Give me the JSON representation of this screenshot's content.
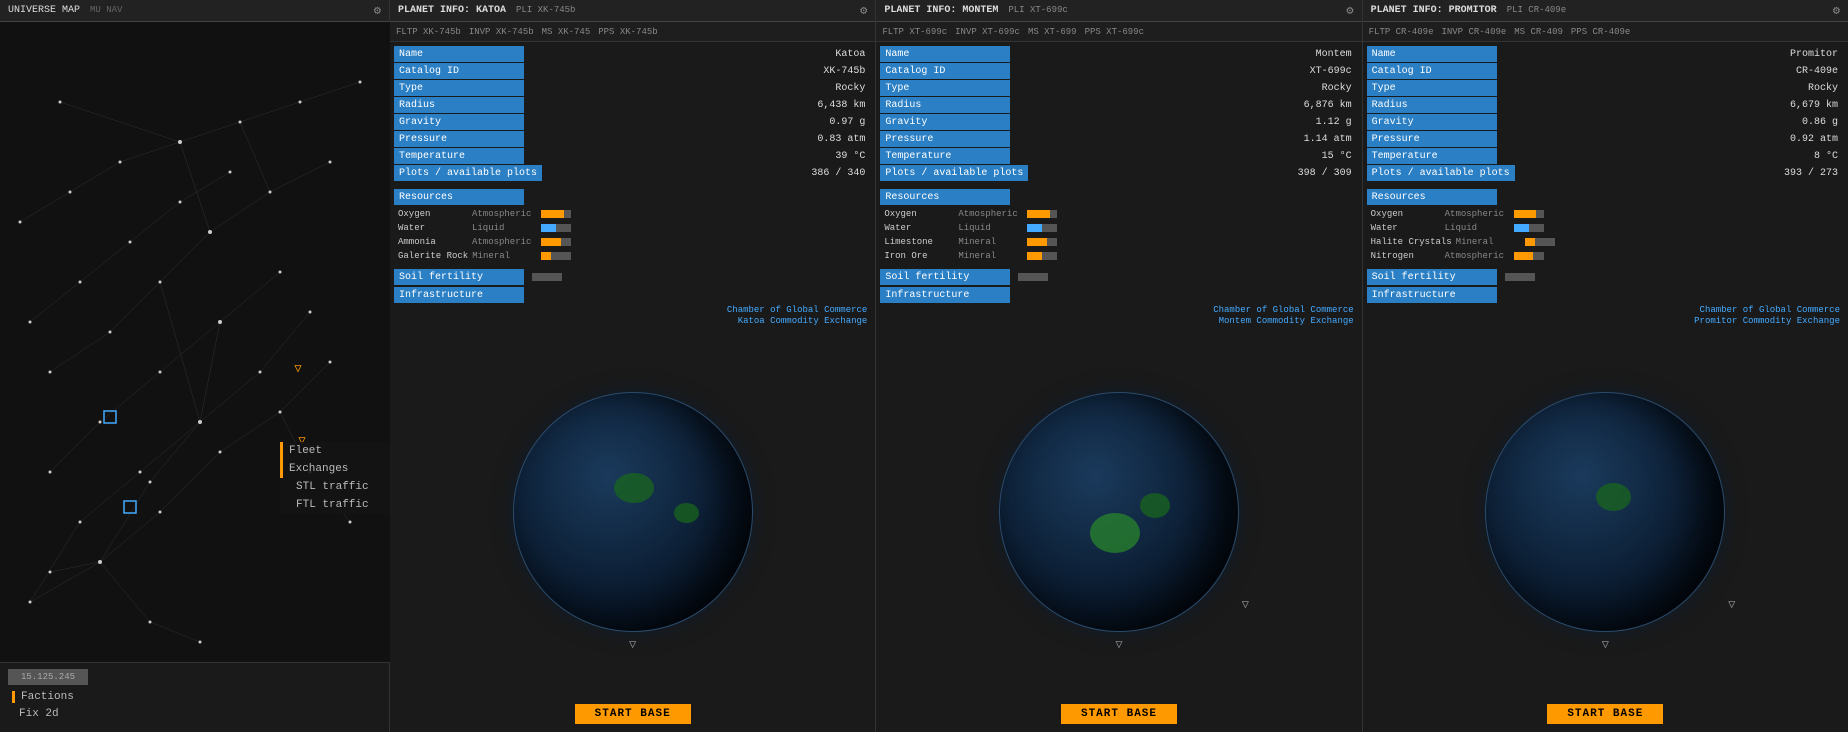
{
  "universeMap": {
    "title": "UNIVERSE MAP",
    "subtitle": "MU NAV",
    "sidebar": {
      "items": [
        {
          "label": "Fleet",
          "active": true
        },
        {
          "label": "Exchanges",
          "active": true
        },
        {
          "label": "STL traffic",
          "active": false
        },
        {
          "label": "FTL traffic",
          "active": false
        }
      ]
    },
    "bottom": {
      "coords": "15.125.245",
      "items": [
        {
          "label": "Factions"
        },
        {
          "label": "Fix 2d"
        }
      ]
    }
  },
  "planets": [
    {
      "title": "PLANET INFO: KATOA",
      "titleShort": "KATOA",
      "id": "PLI XK-745b",
      "navBar": {
        "fltp": "FLTP XK-745b",
        "invp": "INVP XK-745b",
        "ms": "MS XK-745",
        "pps": "PPS XK-745b"
      },
      "fields": [
        {
          "label": "Name",
          "value": "Katoa"
        },
        {
          "label": "Catalog ID",
          "value": "XK-745b"
        },
        {
          "label": "Type",
          "value": "Rocky"
        },
        {
          "label": "Radius",
          "value": "6,438 km"
        },
        {
          "label": "Gravity",
          "value": "0.97 g"
        },
        {
          "label": "Pressure",
          "value": "0.83 atm"
        },
        {
          "label": "Temperature",
          "value": "39 °C"
        },
        {
          "label": "Plots / available plots",
          "value": "386 / 340"
        }
      ],
      "resources": [
        {
          "name": "Oxygen",
          "type": "Atmospheric",
          "fillClass": "three-quarters",
          "color": "orange"
        },
        {
          "name": "Water",
          "type": "Liquid",
          "fillClass": "half",
          "color": "blue"
        },
        {
          "name": "Ammonia",
          "type": "Atmospheric",
          "fillClass": "two-thirds",
          "color": "orange"
        },
        {
          "name": "Galerite Rock",
          "type": "Mineral",
          "fillClass": "one-third",
          "color": "orange"
        }
      ],
      "soilFertility": "",
      "infrastructure": {
        "links": [
          "Chamber of Global Commerce",
          "Katoa Commodity Exchange"
        ]
      },
      "startBaseLabel": "START BASE"
    },
    {
      "title": "PLANET INFO: MONTEM",
      "titleShort": "MONTEM",
      "id": "PLI XT-699c",
      "navBar": {
        "fltp": "FLTP XT-699c",
        "invp": "INVP XT-699c",
        "ms": "MS XT-699",
        "pps": "PPS XT-699c"
      },
      "fields": [
        {
          "label": "Name",
          "value": "Montem"
        },
        {
          "label": "Catalog ID",
          "value": "XT-699c"
        },
        {
          "label": "Type",
          "value": "Rocky"
        },
        {
          "label": "Radius",
          "value": "6,876 km"
        },
        {
          "label": "Gravity",
          "value": "1.12 g"
        },
        {
          "label": "Pressure",
          "value": "1.14 atm"
        },
        {
          "label": "Temperature",
          "value": "15 °C"
        },
        {
          "label": "Plots / available plots",
          "value": "398 / 309"
        }
      ],
      "resources": [
        {
          "name": "Oxygen",
          "type": "Atmospheric",
          "fillClass": "three-quarters",
          "color": "orange"
        },
        {
          "name": "Water",
          "type": "Liquid",
          "fillClass": "half",
          "color": "blue"
        },
        {
          "name": "Limestone",
          "type": "Mineral",
          "fillClass": "two-thirds",
          "color": "orange"
        },
        {
          "name": "Iron Ore",
          "type": "Mineral",
          "fillClass": "half",
          "color": "orange"
        }
      ],
      "soilFertility": "",
      "infrastructure": {
        "links": [
          "Chamber of Global Commerce",
          "Montem Commodity Exchange"
        ]
      },
      "startBaseLabel": "START BASE"
    },
    {
      "title": "PLANET INFO: PROMITOR",
      "titleShort": "PROMITOR",
      "id": "PLI CR-409e",
      "navBar": {
        "fltp": "FLTP CR-409e",
        "invp": "INVP CR-409e",
        "ms": "MS CR-409",
        "pps": "PPS CR-409e"
      },
      "fields": [
        {
          "label": "Name",
          "value": "Promitor"
        },
        {
          "label": "Catalog ID",
          "value": "CR-409e"
        },
        {
          "label": "Type",
          "value": "Rocky"
        },
        {
          "label": "Radius",
          "value": "6,679 km"
        },
        {
          "label": "Gravity",
          "value": "0.86 g"
        },
        {
          "label": "Pressure",
          "value": "0.92 atm"
        },
        {
          "label": "Temperature",
          "value": "8 °C"
        },
        {
          "label": "Plots / available plots",
          "value": "393 / 273"
        }
      ],
      "resources": [
        {
          "name": "Oxygen",
          "type": "Atmospheric",
          "fillClass": "three-quarters",
          "color": "orange"
        },
        {
          "name": "Water",
          "type": "Liquid",
          "fillClass": "half",
          "color": "blue"
        },
        {
          "name": "Halite Crystals",
          "type": "Mineral",
          "fillClass": "one-third",
          "color": "orange"
        },
        {
          "name": "Nitrogen",
          "type": "Atmospheric",
          "fillClass": "two-thirds",
          "color": "orange"
        }
      ],
      "soilFertility": "",
      "infrastructure": {
        "links": [
          "Chamber of Global Commerce",
          "Promitor Commodity Exchange"
        ]
      },
      "startBaseLabel": "START BASE"
    }
  ],
  "icons": {
    "gear": "⚙",
    "navIndicator": "▽",
    "fleetIndicator": "▽"
  }
}
